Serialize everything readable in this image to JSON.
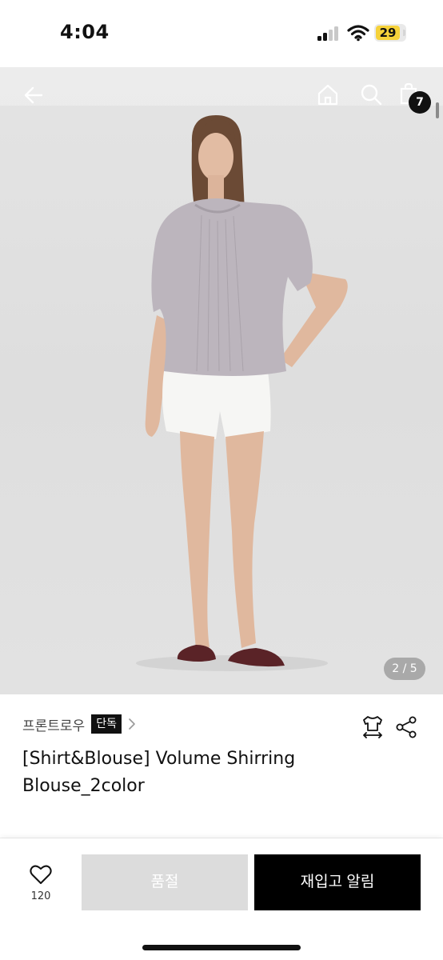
{
  "status_bar": {
    "time": "4:04",
    "battery_level": "29"
  },
  "nav": {
    "back_icon": "arrow-left-icon",
    "home_icon": "home-icon",
    "search_icon": "search-icon",
    "cart_icon": "shopping-bag-icon",
    "cart_count": "7"
  },
  "gallery": {
    "page_indicator": "2 / 5",
    "current_page": 2,
    "total_pages": 5
  },
  "product": {
    "brand": "프론트로우",
    "exclusive_badge": "단독",
    "title": "[Shirt&Blouse] Volume Shirring Blouse_2color",
    "size_icon": "size-guide-icon",
    "share_icon": "share-icon"
  },
  "actions": {
    "like_icon": "heart-icon",
    "like_count": "120",
    "soldout_label": "품절",
    "restock_label": "재입고 알림"
  },
  "colors": {
    "primary_button": "#000000",
    "disabled_button": "#dcdcdc",
    "battery_fill": "#f6d23a"
  }
}
